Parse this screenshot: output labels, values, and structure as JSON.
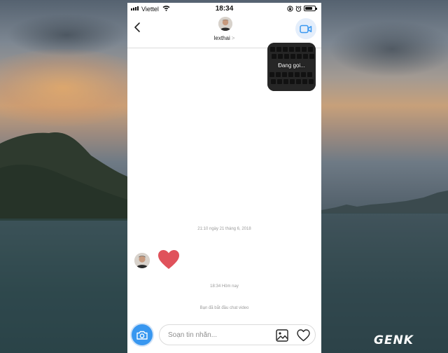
{
  "status_bar": {
    "carrier": "Viettel",
    "time": "18:34",
    "battery_level": 0.75
  },
  "header": {
    "username": "lexthai",
    "chevron": ">"
  },
  "video_message": {
    "label": "Đang gọi..."
  },
  "conversation": {
    "timestamp_1": "21:10 ngày 21 tháng 6, 2018",
    "timestamp_2": "18:34 Hôm nay",
    "system_message": "Bạn đã bắt đầu chat video"
  },
  "composer": {
    "placeholder": "Soạn tin nhắn..."
  },
  "watermark": {
    "text": "GENK"
  },
  "icons": {
    "back": "chevron-left-icon",
    "video_call": "video-camera-icon",
    "camera": "camera-icon",
    "gallery": "image-icon",
    "like": "heart-icon",
    "heart_message": "heart-icon"
  },
  "colors": {
    "accent_blue": "#3897f0",
    "heart_red": "#e0525b",
    "video_call_bg": "#e4eefb"
  }
}
